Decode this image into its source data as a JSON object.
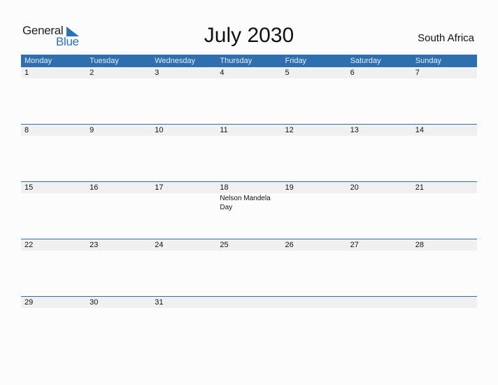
{
  "logo": {
    "general": "General",
    "blue": "Blue"
  },
  "title": "July 2030",
  "country": "South Africa",
  "colors": {
    "header": "#2e6fb0",
    "brand": "#2a72b8",
    "date_row": "#f0f0f0"
  },
  "weekdays": [
    "Monday",
    "Tuesday",
    "Wednesday",
    "Thursday",
    "Friday",
    "Saturday",
    "Sunday"
  ],
  "weeks": [
    {
      "days": [
        "1",
        "2",
        "3",
        "4",
        "5",
        "6",
        "7"
      ],
      "events": [
        "",
        "",
        "",
        "",
        "",
        "",
        ""
      ]
    },
    {
      "days": [
        "8",
        "9",
        "10",
        "11",
        "12",
        "13",
        "14"
      ],
      "events": [
        "",
        "",
        "",
        "",
        "",
        "",
        ""
      ]
    },
    {
      "days": [
        "15",
        "16",
        "17",
        "18",
        "19",
        "20",
        "21"
      ],
      "events": [
        "",
        "",
        "",
        "Nelson Mandela Day",
        "",
        "",
        ""
      ]
    },
    {
      "days": [
        "22",
        "23",
        "24",
        "25",
        "26",
        "27",
        "28"
      ],
      "events": [
        "",
        "",
        "",
        "",
        "",
        "",
        ""
      ]
    },
    {
      "days": [
        "29",
        "30",
        "31",
        "",
        "",
        "",
        ""
      ],
      "events": [
        "",
        "",
        "",
        "",
        "",
        "",
        ""
      ]
    }
  ]
}
